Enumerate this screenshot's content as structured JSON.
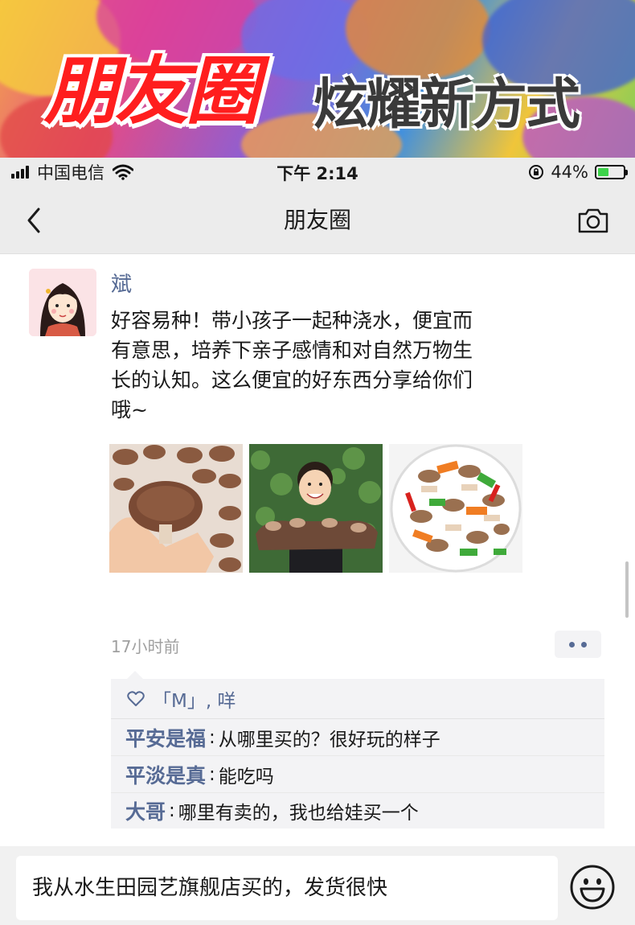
{
  "banner": {
    "title_main": "朋友圈",
    "title_sub": "炫耀新方式"
  },
  "status_bar": {
    "carrier": "中国电信",
    "time": "下午 2:14",
    "battery": "44%",
    "battery_level": 0.44
  },
  "nav": {
    "title": "朋友圈",
    "back_icon": "chevron-left-icon",
    "camera_icon": "camera-icon"
  },
  "post": {
    "author": "斌",
    "text": "好容易种！带小孩子一起种浇水，便宜而有意思，培养下亲子感情和对自然万物生长的认知。这么便宜的好东西分享给你们哦~",
    "photos": [
      "mushrooms-in-hand",
      "child-with-mushroom-log",
      "stir-fried-mushrooms"
    ],
    "timestamp": "17小时前",
    "likes": "「M」, 咩",
    "comments": [
      {
        "name": "平安是福",
        "separator": ":",
        "text": "从哪里买的？很好玩的样子"
      },
      {
        "name": "平淡是真",
        "separator": ":",
        "text": "能吃吗"
      },
      {
        "name": "大哥",
        "separator": ":",
        "text": "哪里有卖的，我也给娃买一个"
      }
    ]
  },
  "input": {
    "value": "我从水生田园艺旗舰店买的，发货很快",
    "emoji_icon": "smiley-icon"
  },
  "colors": {
    "link_blue": "#576b95",
    "bar_gray": "#ececec",
    "banner_red": "#ff1e1e"
  }
}
